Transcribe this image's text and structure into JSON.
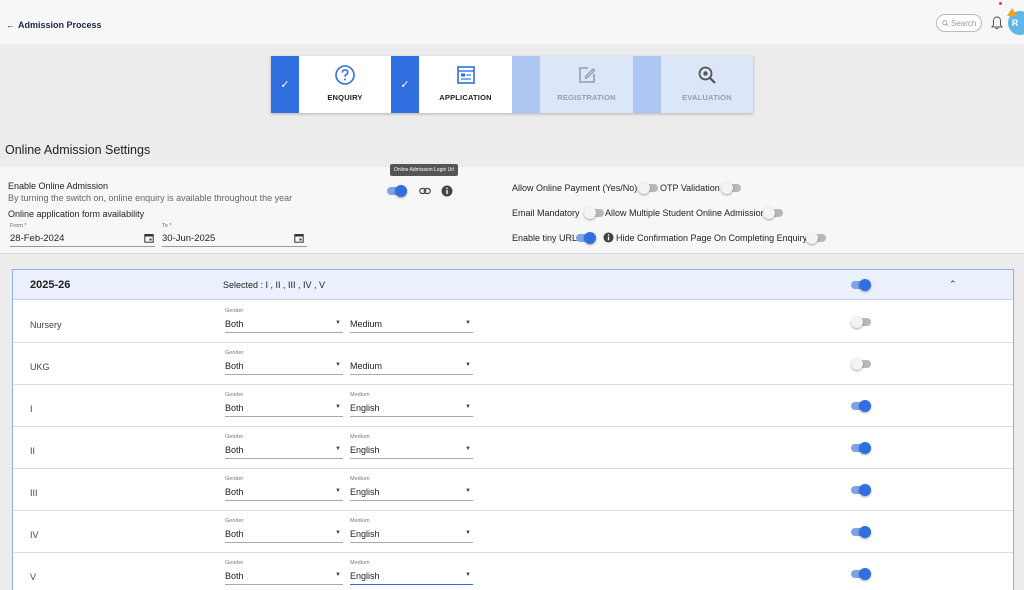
{
  "header": {
    "back_label": "Admission Process",
    "search_placeholder": "Search",
    "avatar_initial": "R"
  },
  "steps": [
    {
      "label": "ENQUIRY",
      "status": "done",
      "icon": "help-circle-icon"
    },
    {
      "label": "APPLICATION",
      "status": "done",
      "icon": "form-list-icon"
    },
    {
      "label": "REGISTRATION",
      "status": "pending",
      "icon": "edit-square-icon"
    },
    {
      "label": "EVALUATION",
      "status": "pending",
      "icon": "magnify-gear-icon"
    }
  ],
  "section_title": "Online Admission Settings",
  "settings": {
    "tooltip": "Online Admission Login Url",
    "enable_label": "Enable Online Admission",
    "enable_desc": "By turning the switch on, online enquiry is available throughout the year",
    "enable_on": true,
    "availability_label": "Online application form availability",
    "from_caption": "From *",
    "from_value": "28-Feb-2024",
    "to_caption": "To *",
    "to_value": "30-Jun-2025",
    "allow_payment_label": "Allow Online Payment (Yes/No)",
    "allow_payment_on": false,
    "otp_label": "OTP Validation",
    "otp_on": false,
    "email_label": "Email Mandatory",
    "email_on": false,
    "multiple_label": "Allow Multiple Student Online Admission",
    "multiple_on": false,
    "tiny_url_label": "Enable tiny URL",
    "tiny_url_on": true,
    "hide_confirm_label": "Hide Confirmation Page On Completing Enquiry",
    "hide_confirm_on": false
  },
  "year_block": {
    "year": "2025-26",
    "selected": "Selected : I , II , III , IV , V",
    "enabled": true,
    "expanded_icon": "chevron-up-icon",
    "rows": [
      {
        "name": "Nursery",
        "gender_caption": "Gender",
        "gender": "Both",
        "medium_caption": "",
        "medium": "Medium",
        "enabled": false
      },
      {
        "name": "UKG",
        "gender_caption": "Gender",
        "gender": "Both",
        "medium_caption": "",
        "medium": "Medium",
        "enabled": false
      },
      {
        "name": "I",
        "gender_caption": "Gender",
        "gender": "Both",
        "medium_caption": "Medium",
        "medium": "English",
        "enabled": true
      },
      {
        "name": "II",
        "gender_caption": "Gender",
        "gender": "Both",
        "medium_caption": "Medium",
        "medium": "English",
        "enabled": true
      },
      {
        "name": "III",
        "gender_caption": "Gender",
        "gender": "Both",
        "medium_caption": "Medium",
        "medium": "English",
        "enabled": true
      },
      {
        "name": "IV",
        "gender_caption": "Gender",
        "gender": "Both",
        "medium_caption": "Medium",
        "medium": "English",
        "enabled": true
      },
      {
        "name": "V",
        "gender_caption": "Gender",
        "gender": "Both",
        "medium_caption": "Medium",
        "medium": "English",
        "enabled": true
      }
    ]
  },
  "colors": {
    "primary": "#2f6fe0",
    "step_pending": "#aec7f2",
    "step_pending_body": "#dbe6f8",
    "row_header_bg": "#eaf1fd"
  }
}
